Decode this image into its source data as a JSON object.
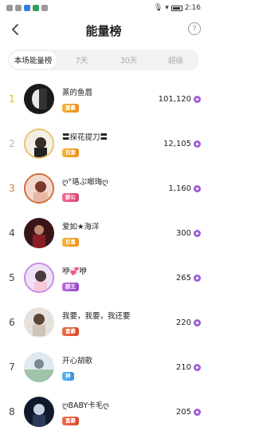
{
  "status_bar": {
    "time": "2:16"
  },
  "header": {
    "title": "能量榜",
    "help": "?"
  },
  "tabs": [
    {
      "label": "本场能量榜",
      "active": true
    },
    {
      "label": "7天",
      "active": false
    },
    {
      "label": "30天",
      "active": false
    },
    {
      "label": "超级",
      "active": false
    }
  ],
  "ranking": [
    {
      "rank": "1",
      "name": "蒸的鱼唇",
      "badge": "富豪",
      "badge_color": "orange",
      "value": "101,120"
    },
    {
      "rank": "2",
      "name": "〓探花提刀〓",
      "badge": "巨富",
      "badge_color": "orange",
      "value": "12,105"
    },
    {
      "rank": "3",
      "name": "ღ°珞ぷ啣珻ღ",
      "badge": "郡公",
      "badge_color": "pink",
      "value": "1,160"
    },
    {
      "rank": "4",
      "name": "爱如★海洋",
      "badge": "巨富",
      "badge_color": "orange",
      "value": "300"
    },
    {
      "rank": "5",
      "name": "咿💞咿",
      "badge": "郡王",
      "badge_color": "purple",
      "value": "265"
    },
    {
      "rank": "6",
      "name": "我要，我要，我还要",
      "badge": "富豪",
      "badge_color": "red",
      "value": "220"
    },
    {
      "rank": "7",
      "name": "开心胡歌",
      "badge": "神",
      "badge_color": "blue",
      "value": "210"
    },
    {
      "rank": "8",
      "name": "ღBABY卡毛ღ",
      "badge": "富豪",
      "badge_color": "red",
      "value": "205"
    }
  ],
  "currency_icon": "purple-diamond-coin",
  "accent_colors": {
    "gold": "#e6b422",
    "silver": "#b0b0c0",
    "bronze": "#d4782a",
    "coin": "#9c5bd6"
  }
}
